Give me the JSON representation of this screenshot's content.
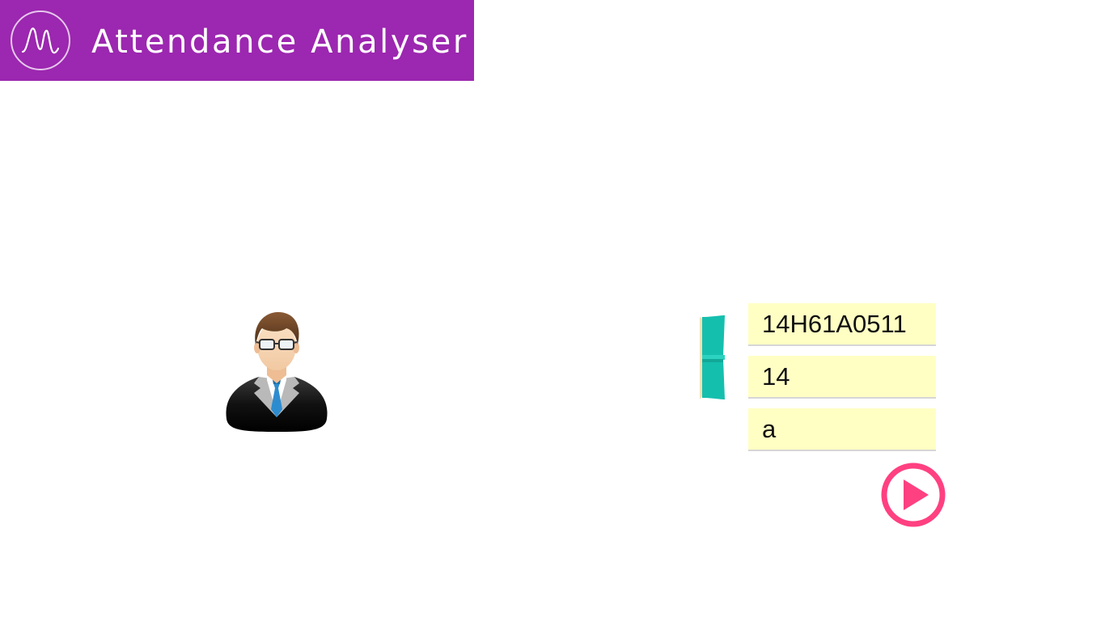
{
  "header": {
    "title": "Attendance Analyser",
    "background": "#9c27b0",
    "logo_icon": "waveform-icon"
  },
  "avatar": {
    "icon": "businessman-avatar-icon"
  },
  "book": {
    "icon": "open-book-icon",
    "color": "#15bfae"
  },
  "form": {
    "field_background": "#ffffc4",
    "fields": [
      {
        "value": "14H61A0511"
      },
      {
        "value": "14"
      },
      {
        "value": "a"
      }
    ],
    "submit": {
      "icon": "play-circle-icon",
      "color": "#ff4081"
    }
  }
}
